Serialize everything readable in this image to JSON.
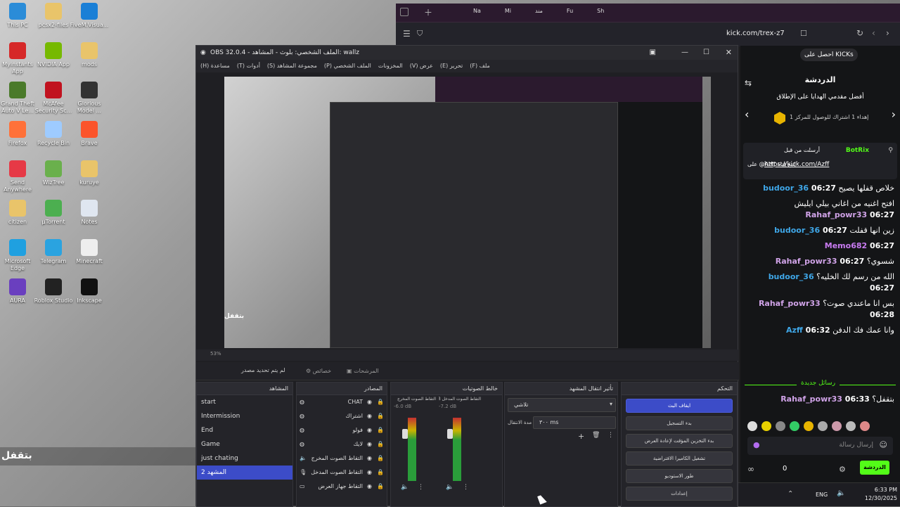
{
  "desktop": {
    "icons": [
      {
        "label": "This PC",
        "color": "#2b8cd8"
      },
      {
        "label": "pcsx2-files",
        "color": "#e9c46a"
      },
      {
        "label": "FiveM.Visua...",
        "color": "#1a7fd6"
      },
      {
        "label": "Myinstants App",
        "color": "#d62828"
      },
      {
        "label": "NVIDIA App",
        "color": "#76b900"
      },
      {
        "label": "mods",
        "color": "#e9c46a"
      },
      {
        "label": "Grand Theft Auto V Le...",
        "color": "#4a7a2a"
      },
      {
        "label": "McAfee Security Sc...",
        "color": "#c1121f"
      },
      {
        "label": "Glorious Model ...",
        "color": "#333333"
      },
      {
        "label": "Firefox",
        "color": "#ff7139"
      },
      {
        "label": "Recycle Bin",
        "color": "#9ecbff"
      },
      {
        "label": "Brave",
        "color": "#fb542b"
      },
      {
        "label": "Send Anywhere",
        "color": "#e63946"
      },
      {
        "label": "WizTree",
        "color": "#6ab04c"
      },
      {
        "label": "kuruye",
        "color": "#e9c46a"
      },
      {
        "label": "citizen",
        "color": "#e9c46a"
      },
      {
        "label": "µTorrent",
        "color": "#4caf50"
      },
      {
        "label": "Notes",
        "color": "#dfe6f0"
      },
      {
        "label": "Microsoft Edge",
        "color": "#1fa0e0"
      },
      {
        "label": "Telegram",
        "color": "#2aa3e0"
      },
      {
        "label": "Minecraft",
        "color": "#eeeeee"
      },
      {
        "label": "AURA",
        "color": "#6a3fbf"
      },
      {
        "label": "Roblox Studio",
        "color": "#222222"
      },
      {
        "label": "Inkscape",
        "color": "#111111"
      }
    ],
    "overlay_text": "بتقفل"
  },
  "browser": {
    "tabs": [
      "Na",
      "Mi",
      "مند",
      "Fu",
      "Sh"
    ],
    "url": "kick.com/trex-z7",
    "kick": {
      "get_kicks": "احصل على KICKs",
      "chat_title": "الدردشة",
      "top_gifters": "أفضل مقدمي الهدايا على الإطلاق",
      "gift_line": "إهداء 1 اشتراك للوصول للمركز 1",
      "pinned_by": "أرسلت من قبل",
      "pinned_user": "BotRix",
      "pinned_msg": "على @Azff إتبع قناة",
      "pinned_link": "https://kick.com/Azff",
      "messages": [
        {
          "time": "06:27",
          "user": "budoor_36",
          "color": "#3fa7e8",
          "text": "خلاص قفلها يصيح"
        },
        {
          "time": "06:27",
          "user": "Rahaf_powr33",
          "color": "#d0a3e8",
          "text": "افتح اغنيه من اغاني بيلي ايليش"
        },
        {
          "time": "06:27",
          "user": "budoor_36",
          "color": "#3fa7e8",
          "text": "زين انها قفلت"
        },
        {
          "time": "06:27",
          "user": "Memo682",
          "color": "#c97bf2",
          "text": ""
        },
        {
          "time": "06:27",
          "user": "Rahaf_powr33",
          "color": "#d0a3e8",
          "text": "شسوي؟"
        },
        {
          "time": "06:27",
          "user": "budoor_36",
          "color": "#3fa7e8",
          "text": "الله من رسم لك الخليه؟"
        },
        {
          "time": "06:28",
          "user": "Rahaf_powr33",
          "color": "#d0a3e8",
          "text": "بس انا ماعندي صوت؟"
        },
        {
          "time": "06:32",
          "user": "Azff",
          "color": "#3fa7e8",
          "text": "وانا عمك فك الدفن"
        }
      ],
      "new_messages": "رسائل جديدة",
      "last_msg": {
        "time": "06:33",
        "user": "Rahaf_powr33",
        "color": "#d0a3e8",
        "text": "بتقفل؟"
      },
      "input_placeholder": "إرسال رسالة",
      "send_label": "الدردشة",
      "viewers": "0"
    }
  },
  "taskbar": {
    "lang": "ENG",
    "time": "6:33 PM",
    "date": "12/30/2025"
  },
  "obs": {
    "title": "OBS 32.0.4 - الملف الشخصي: بلوث - المشاهد: wallz",
    "menu": [
      "ملف (F)",
      "تحرير (E)",
      "عرض (V)",
      "المخزونات",
      "الملف الشخصي (P)",
      "مجموعة المشاهد (S)",
      "أدوات (T)",
      "مساعدة (H)"
    ],
    "zoom": "53%",
    "preview_footer": "لم يتم تحديد مصدر",
    "properties": "خصائص",
    "filters": "المرشحات",
    "preview_overlay": "بتقفل",
    "scenes_title": "المشاهد",
    "scenes": [
      "start",
      "Intermission",
      "End",
      "Game",
      "just chating",
      "المشهد 2"
    ],
    "selected_scene_index": 5,
    "sources_title": "المصادر",
    "sources": [
      {
        "name": "CHAT",
        "icon": "globe-icon"
      },
      {
        "name": "اشتراك",
        "icon": "globe-icon"
      },
      {
        "name": "فولو",
        "icon": "globe-icon"
      },
      {
        "name": "لايك",
        "icon": "globe-icon"
      },
      {
        "name": "التقاط الصوت المخرج",
        "icon": "speaker-icon"
      },
      {
        "name": "التقاط الصوت المدخل",
        "icon": "mic-icon"
      },
      {
        "name": "التقاط جهاز العرض",
        "icon": "monitor-icon"
      }
    ],
    "mixer_title": "خالط الصوتيات",
    "mixer": [
      {
        "name": "التقاط الصوت المخرج",
        "db": "-6.0 dB"
      },
      {
        "name": "التقاط الصوت المدخل 3",
        "db": "-7.2 dB"
      }
    ],
    "transition_title": "تأثير انتقال المشهد",
    "transition_type": "تلاشي",
    "duration_label": "مدة الانتقال",
    "duration_value": "٣٠٠ ms",
    "controls_title": "التحكم",
    "controls": [
      "ايقاف البث",
      "بدء التسجيل",
      "بدء التخزين المؤقت لإعادة العرض",
      "تشغيل الكاميرا الافتراضية",
      "طور الاستوديو",
      "إعدادات"
    ]
  }
}
